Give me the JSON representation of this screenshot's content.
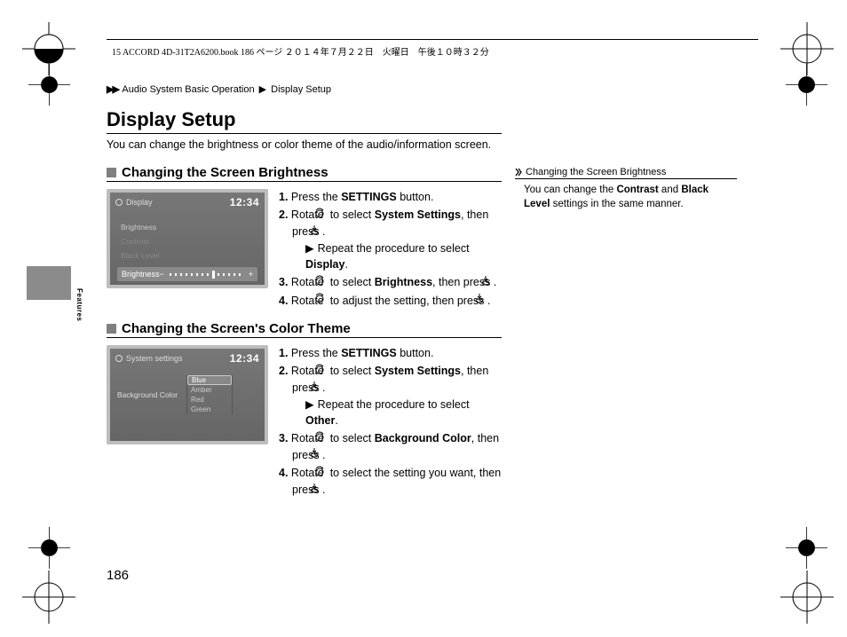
{
  "header_text": "15 ACCORD 4D-31T2A6200.book  186 ページ  ２０１４年７月２２日　火曜日　午後１０時３２分",
  "breadcrumb": {
    "item1": "Audio System Basic Operation",
    "item2": "Display Setup"
  },
  "title": "Display Setup",
  "intro": "You can change the brightness or color theme of the audio/information screen.",
  "page_number": "186",
  "tab_label": "Features",
  "section1": {
    "heading": "Changing the Screen Brightness",
    "screenshot": {
      "title": "Display",
      "time": "12:34",
      "rows": [
        "Brightness",
        "Contrast",
        "Black Level"
      ],
      "highlight_label": "Brightness",
      "slider_minus": "−",
      "slider_plus": "+"
    },
    "steps": {
      "s1a": "Press the ",
      "s1b": "SETTINGS",
      "s1c": " button.",
      "s2a": "Rotate ",
      "s2b": " to select ",
      "s2c": "System Settings",
      "s2d": ", then press ",
      "s2e": ".",
      "s2sub_a": "Repeat the procedure to select ",
      "s2sub_b": "Display",
      "s2sub_c": ".",
      "s3a": "Rotate ",
      "s3b": " to select ",
      "s3c": "Brightness",
      "s3d": ", then press ",
      "s3e": ".",
      "s4a": "Rotate ",
      "s4b": " to adjust the setting, then press ",
      "s4c": "."
    }
  },
  "section2": {
    "heading": "Changing the Screen's Color Theme",
    "screenshot": {
      "title": "System settings",
      "time": "12:34",
      "row_label": "Background Color",
      "options": [
        "Blue",
        "Amber",
        "Red",
        "Green"
      ],
      "selected": "Blue"
    },
    "steps": {
      "s1a": "Press the ",
      "s1b": "SETTINGS",
      "s1c": " button.",
      "s2a": "Rotate ",
      "s2b": " to select ",
      "s2c": "System Settings",
      "s2d": ", then press ",
      "s2e": ".",
      "s2sub_a": "Repeat the procedure to select ",
      "s2sub_b": "Other",
      "s2sub_c": ".",
      "s3a": "Rotate ",
      "s3b": " to select ",
      "s3c": "Background Color",
      "s3d": ", then press ",
      "s3e": ".",
      "s4a": "Rotate ",
      "s4b": " to select the setting you want, then press ",
      "s4c": "."
    }
  },
  "sidebar": {
    "heading": "Changing the Screen Brightness",
    "body_a": "You can change the ",
    "body_b": "Contrast",
    "body_c": " and ",
    "body_d": "Black Level",
    "body_e": " settings in the same manner."
  }
}
